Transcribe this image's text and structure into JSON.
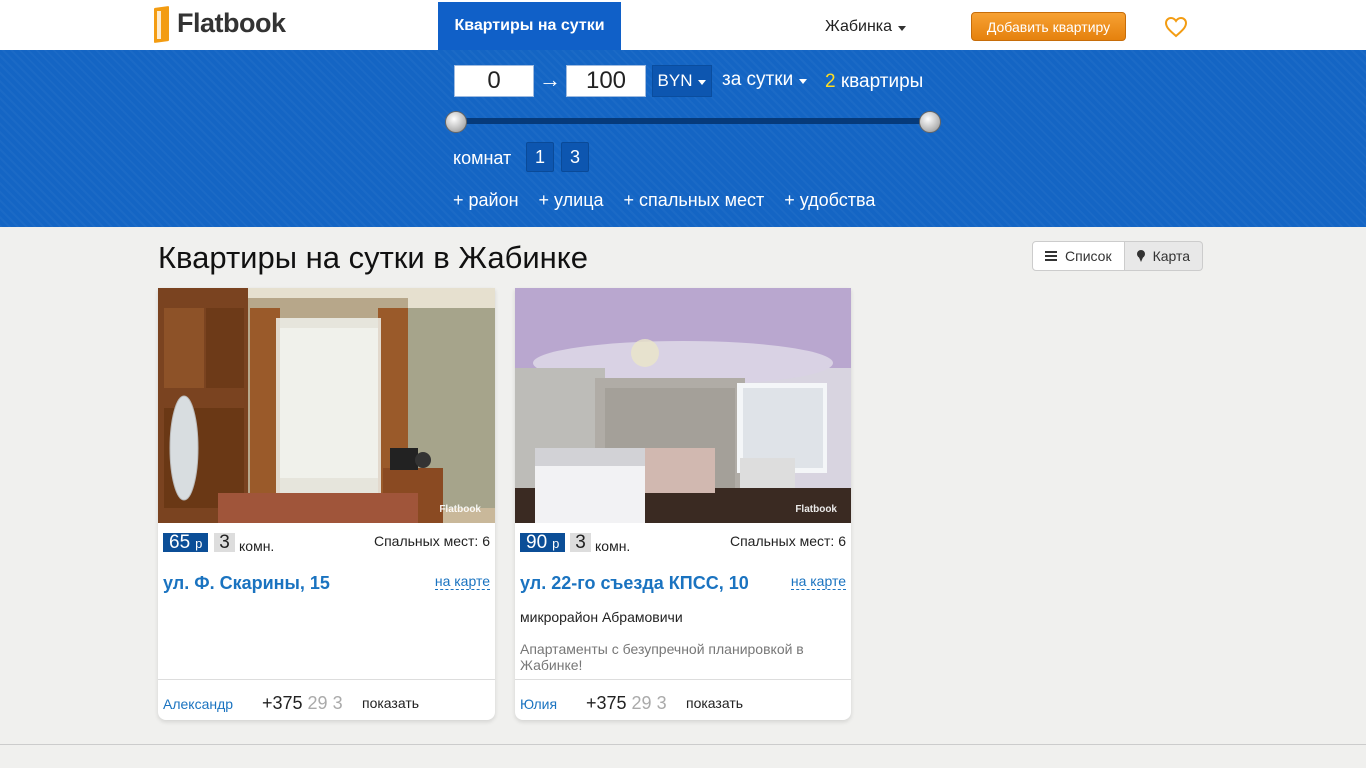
{
  "header": {
    "logo_text": "Flatbook",
    "nav_active": "Квартиры на сутки",
    "city": "Жабинка",
    "add_button": "Добавить квартиру",
    "favorites_icon": "heart-icon",
    "accent_color": "#1465c4",
    "button_color": "#f39c12"
  },
  "filters": {
    "price_from": "0",
    "price_arrow": "→",
    "price_to": "100",
    "currency": "BYN",
    "period": "за сутки",
    "count_number": "2",
    "count_label": "квартиры",
    "slider_min_fraction": 0,
    "slider_max_fraction": 1,
    "rooms_label": "комнат",
    "rooms": [
      "1",
      "3"
    ],
    "more": [
      "+ район",
      "+ улица",
      "+ спальных мест",
      "+ удобства"
    ]
  },
  "main": {
    "title": "Квартиры на сутки в Жабинке",
    "view_list": "Список",
    "view_map": "Карта"
  },
  "listings": [
    {
      "price": "65",
      "currency_short": "р",
      "rooms": "3",
      "rooms_suffix": "комн.",
      "beds": "Спальных мест: 6",
      "address": "ул. Ф. Скарины, 15",
      "map_link": "на карте",
      "district": "",
      "description": "",
      "owner": "Александр",
      "phone_visible": "+375 ",
      "phone_faded": "29 3",
      "show": "показать"
    },
    {
      "price": "90",
      "currency_short": "р",
      "rooms": "3",
      "rooms_suffix": "комн.",
      "beds": "Спальных мест: 6",
      "address": "ул. 22-го съезда КПСС, 10",
      "map_link": "на карте",
      "district": "микрорайон Абрамовичи",
      "description": "Апартаменты с безупречной планировкой в Жабинке!",
      "owner": "Юлия",
      "phone_visible": "+375 ",
      "phone_faded": "29 3",
      "show": "показать"
    }
  ],
  "photo_watermark": "Flatbook"
}
